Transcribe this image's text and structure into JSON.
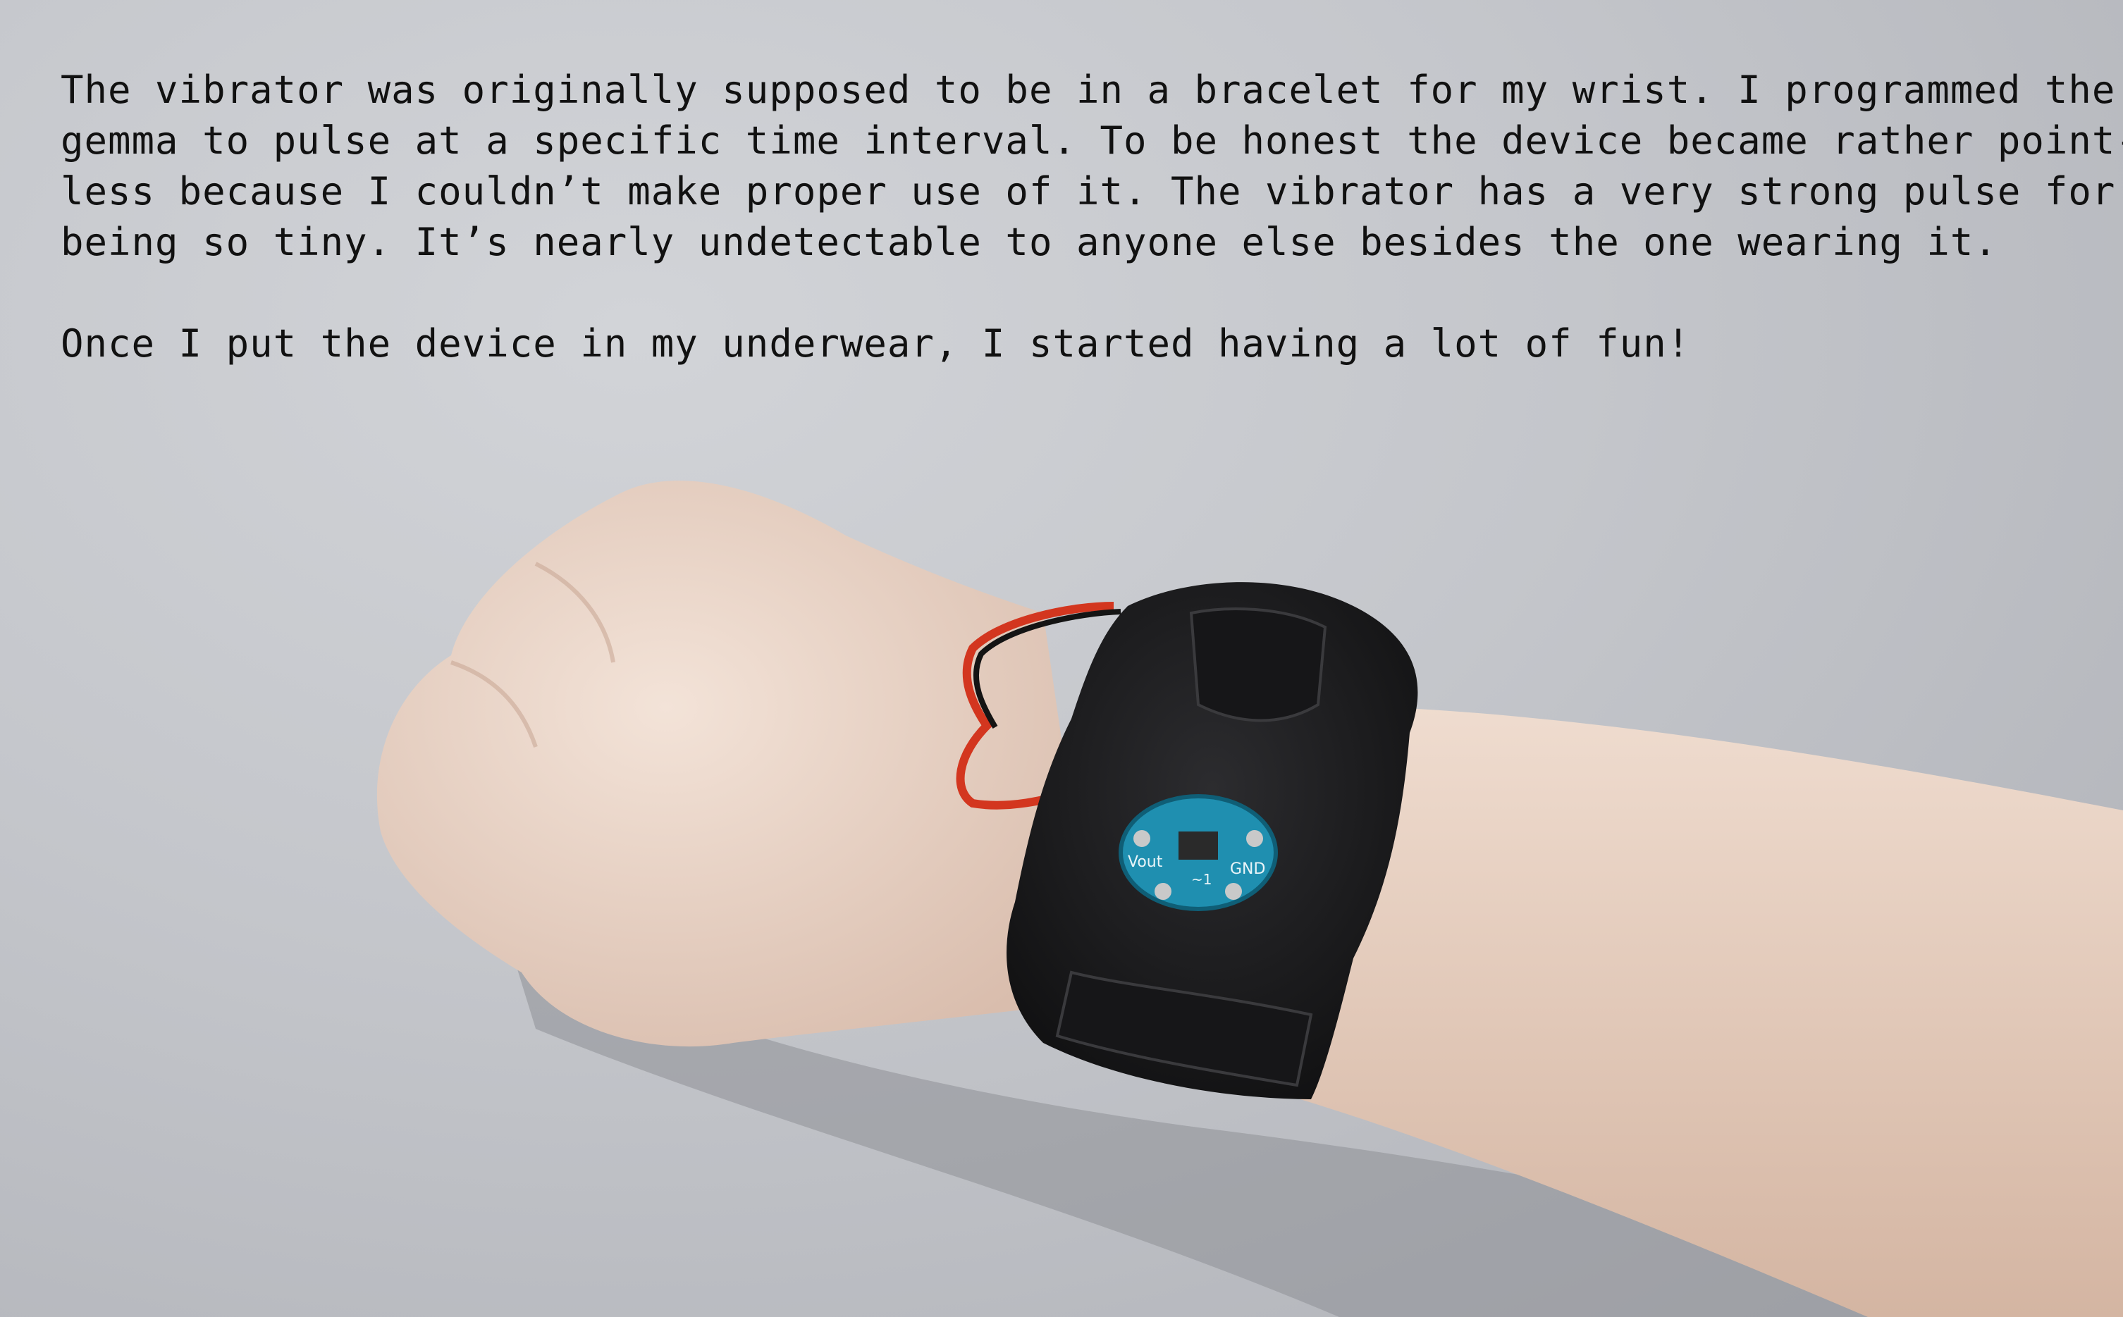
{
  "caption": {
    "lines": [
      "The vibrator was originally supposed to be in a bracelet for my wrist. I programmed the",
      "gemma to pulse at a specific time interval. To be honest the device became rather point-",
      "less because I couldn’t make proper use of it. The vibrator has a very strong pulse for",
      "being so tiny. It’s nearly undetectable to anyone else besides the one wearing it."
    ],
    "closing_line": "Once I put the device in my underwear, I started having a lot of fun!"
  },
  "board_labels": {
    "vout": "Vout",
    "gnd": "GND",
    "pin1": "~1"
  },
  "colors": {
    "background": "#c6c8cd",
    "skin": "#ecd9cc",
    "leather": "#1b1b1d",
    "board": "#1f8fb0",
    "wire_red": "#d3361f",
    "wire_black": "#141414"
  }
}
